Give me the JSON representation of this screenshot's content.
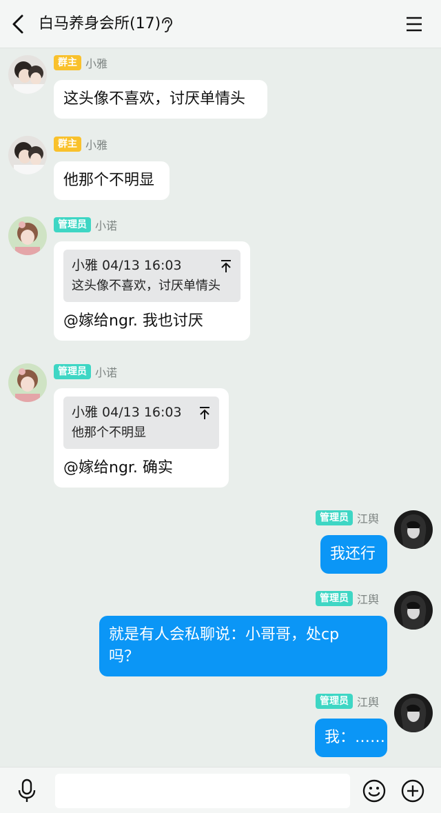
{
  "header": {
    "title": "白马养身会所(17)",
    "back_icon": "chevron-left-icon",
    "ear_icon": "ear-icon",
    "menu_icon": "menu-icon"
  },
  "messages": [
    {
      "sender": "小雅",
      "badge": "群主",
      "text": "这头像不喜欢，讨厌单情头",
      "side": "left"
    },
    {
      "sender": "小雅",
      "badge": "群主",
      "text": "他那个不明显",
      "side": "left"
    },
    {
      "sender": "小诺",
      "badge": "管理员",
      "side": "left",
      "quote": {
        "header": "小雅 04/13 16:03",
        "text": "这头像不喜欢，讨厌单情头"
      },
      "text": "@嫁给ngr. 我也讨厌"
    },
    {
      "sender": "小诺",
      "badge": "管理员",
      "side": "left",
      "quote": {
        "header": "小雅 04/13 16:03",
        "text": "他那个不明显"
      },
      "text": "@嫁给ngr. 确实"
    },
    {
      "sender": "江舆",
      "badge": "管理员",
      "text": "我还行",
      "side": "right"
    },
    {
      "sender": "江舆",
      "badge": "管理员",
      "text_line1": "就是有人会私聊说：小哥哥，处cp",
      "text_line2": "吗？",
      "side": "right"
    },
    {
      "sender": "江舆",
      "badge": "管理员",
      "text": "我：……",
      "side": "right"
    }
  ],
  "input_bar": {
    "placeholder": "",
    "mic_icon": "microphone-icon",
    "emoji_icon": "emoji-icon",
    "plus_icon": "plus-circle-icon"
  },
  "colors": {
    "background": "#e9eeeb",
    "self_bubble": "#0b96f6",
    "owner_badge": "#f9c12c",
    "admin_badge": "#3ed6c4"
  }
}
